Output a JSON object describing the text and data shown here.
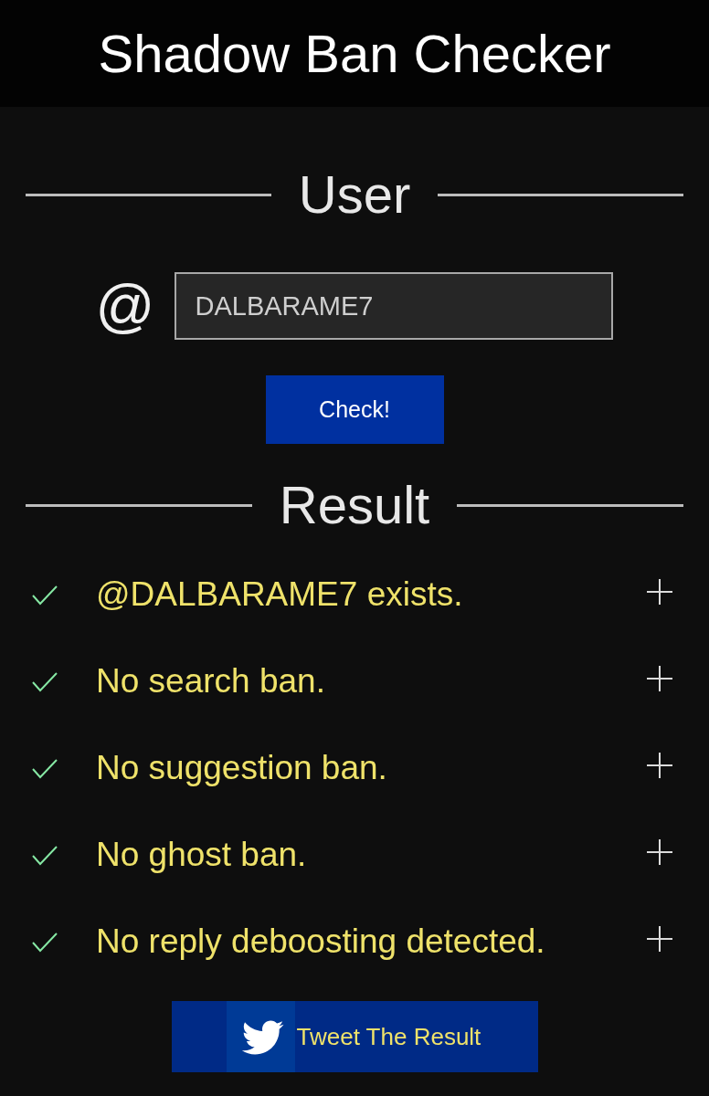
{
  "header": {
    "title": "Shadow Ban Checker"
  },
  "user_section": {
    "heading": "User",
    "at_sign": "@",
    "username_field": {
      "value": "DALBARAME7"
    },
    "check_button": "Check!"
  },
  "result_section": {
    "heading": "Result",
    "items": [
      {
        "text": "@DALBARAME7 exists.",
        "passed": true,
        "expanded": false
      },
      {
        "text": "No search ban.",
        "passed": true,
        "expanded": false
      },
      {
        "text": "No suggestion ban.",
        "passed": true,
        "expanded": false
      },
      {
        "text": "No ghost ban.",
        "passed": true,
        "expanded": false
      },
      {
        "text": "No reply deboosting detected.",
        "passed": true,
        "expanded": false
      }
    ],
    "tweet_button": "Tweet The Result"
  }
}
